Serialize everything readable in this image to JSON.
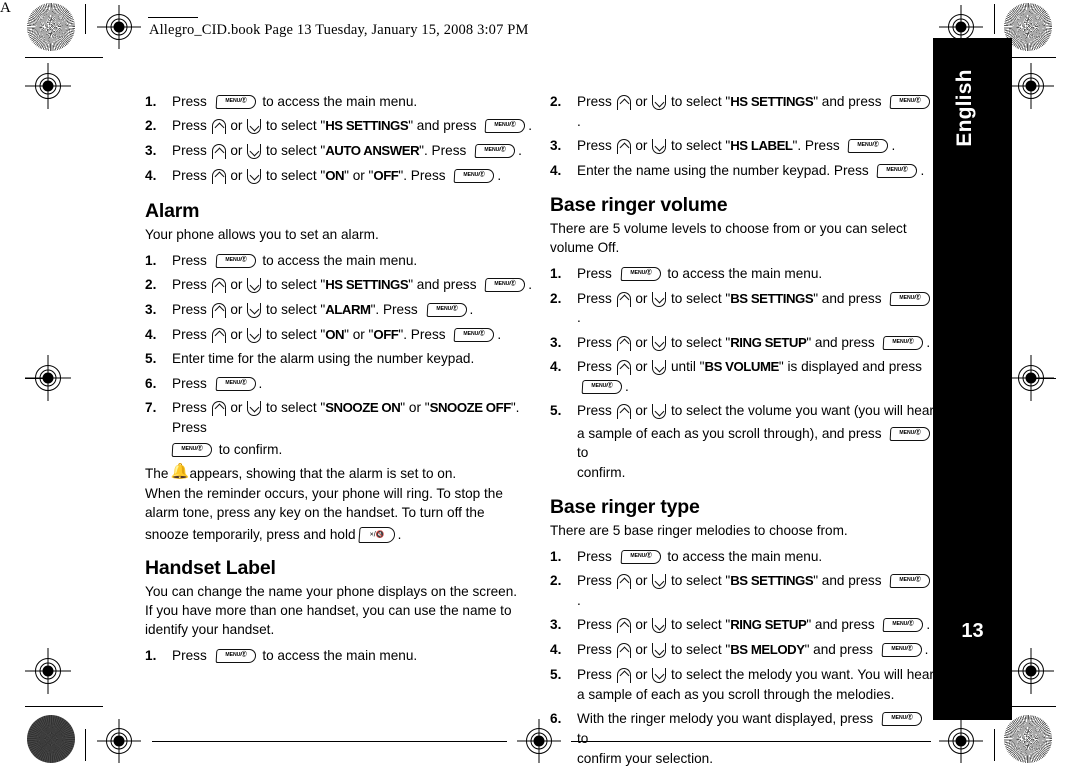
{
  "header": {
    "text": "Allegro_CID.book  Page 13  Tuesday, January 15, 2008  3:07 PM"
  },
  "side_tab": {
    "language": "English",
    "page_number": "13"
  },
  "corner_mark_letter": "A",
  "glyphs": {
    "menu_key": "MENU/Ⓔ",
    "up_key": "up-arrow",
    "down_key": "down-arrow",
    "mute_key": "×/🔇",
    "bell": "bell-icon"
  },
  "left_column": {
    "top_steps": [
      {
        "num": "1",
        "parts": [
          {
            "t": "text",
            "v": "Press"
          },
          {
            "t": "key",
            "v": "menu"
          },
          {
            "t": "text",
            "v": "to access the main menu."
          }
        ]
      },
      {
        "num": "2",
        "parts": [
          {
            "t": "text",
            "v": "Press"
          },
          {
            "t": "key",
            "v": "up"
          },
          {
            "t": "text",
            "v": "or"
          },
          {
            "t": "key",
            "v": "down"
          },
          {
            "t": "text",
            "v": "to select \""
          },
          {
            "t": "disp",
            "v": "HS SETTINGS"
          },
          {
            "t": "text",
            "v": "\" and press"
          },
          {
            "t": "key",
            "v": "menu"
          },
          {
            "t": "text",
            "v": "."
          }
        ]
      },
      {
        "num": "3",
        "parts": [
          {
            "t": "text",
            "v": "Press"
          },
          {
            "t": "key",
            "v": "up"
          },
          {
            "t": "text",
            "v": "or"
          },
          {
            "t": "key",
            "v": "down"
          },
          {
            "t": "text",
            "v": "to select \""
          },
          {
            "t": "disp",
            "v": "AUTO ANSWER"
          },
          {
            "t": "text",
            "v": "\". Press"
          },
          {
            "t": "key",
            "v": "menu"
          },
          {
            "t": "text",
            "v": "."
          }
        ]
      },
      {
        "num": "4",
        "parts": [
          {
            "t": "text",
            "v": "Press"
          },
          {
            "t": "key",
            "v": "up"
          },
          {
            "t": "text",
            "v": "or"
          },
          {
            "t": "key",
            "v": "down"
          },
          {
            "t": "text",
            "v": "to select \""
          },
          {
            "t": "disp",
            "v": "ON"
          },
          {
            "t": "text",
            "v": "\" or \""
          },
          {
            "t": "disp",
            "v": "OFF"
          },
          {
            "t": "text",
            "v": "\". Press"
          },
          {
            "t": "key",
            "v": "menu"
          },
          {
            "t": "text",
            "v": "."
          }
        ]
      }
    ],
    "alarm": {
      "heading": "Alarm",
      "intro": "Your phone allows you to set an alarm.",
      "step1_pre": "Press",
      "step1_post": "to access the main menu.",
      "step2_a": "Press",
      "step2_b": "or",
      "step2_c": "to select \"",
      "step2_disp": "HS SETTINGS",
      "step2_d": "\" and press",
      "step2_e": ".",
      "step3_disp": "ALARM",
      "step3_c": "to select \"",
      "step3_d": "\". Press",
      "step4_on": "ON",
      "step4_off": "OFF",
      "step5": "Enter time for the alarm using the number keypad.",
      "step6_pre": "Press",
      "step6_post": ".",
      "step7_a": "Press",
      "step7_b": "or",
      "step7_c": "to select \"",
      "step7_disp1": "SNOOZE ON",
      "step7_mid": "\" or \"",
      "step7_disp2": "SNOOZE OFF",
      "step7_d": "\". Press",
      "step7_e": "to confirm.",
      "note_a": "The",
      "note_b": "appears, showing that the alarm is set to on.",
      "note_c": "When the reminder occurs, your phone will ring. To stop the",
      "note_d": "alarm tone, press any key on the handset. To turn off the",
      "note_e": "snooze temporarily, press and hold",
      "note_f": "."
    },
    "handset_label": {
      "heading": "Handset Label",
      "para1": "You can change the name your phone displays on the screen.",
      "para2": "If you have more than one handset, you can use the name to",
      "para3": "identify your handset.",
      "step1_pre": "Press",
      "step1_post": "to access the main menu."
    }
  },
  "right_column": {
    "handset_label_cont": {
      "step2_a": "Press",
      "step2_b": "or",
      "step2_c": "to select \"",
      "step2_disp": "HS SETTINGS",
      "step2_d": "\" and press",
      "step2_e": ".",
      "step3_disp": "HS LABEL",
      "step3_d": "\". Press",
      "step4_pre": "Enter the name using the number keypad. Press",
      "step4_post": "."
    },
    "base_ringer_volume": {
      "heading": "Base ringer volume",
      "intro_1": "There are 5 volume levels to choose from or you can select",
      "intro_2": "volume Off.",
      "step1_pre": "Press",
      "step1_post": "to access the main menu.",
      "press": "Press",
      "or": "or",
      "to_select": "to select \"",
      "and_press": "\" and press",
      "period": ".",
      "disp_bs_settings": "BS SETTINGS",
      "disp_ring_setup": "RING SETUP",
      "step4_until": "until \"",
      "disp_bs_volume": "BS VOLUME",
      "step4_mid": "\" is displayed and press",
      "step5_a": "to select the volume you want (you will hear",
      "step5_b": "a sample of each as you scroll through), and press",
      "step5_c": "to",
      "step5_d": "confirm."
    },
    "base_ringer_type": {
      "heading": "Base ringer type",
      "intro": "There are 5 base ringer melodies to choose from.",
      "step1_pre": "Press",
      "step1_post": "to access the main menu.",
      "press": "Press",
      "or": "or",
      "to_select": "to select \"",
      "and_press": "\" and press",
      "period": ".",
      "disp_bs_settings": "BS SETTINGS",
      "disp_ring_setup": "RING SETUP",
      "disp_bs_melody": "BS MELODY",
      "step5_a": "to select the melody you want. You will hear",
      "step5_b": "a sample of each as you scroll through the melodies.",
      "step6_a": "With the ringer melody you want displayed, press",
      "step6_b": "to",
      "step6_c": "confirm your selection."
    }
  }
}
